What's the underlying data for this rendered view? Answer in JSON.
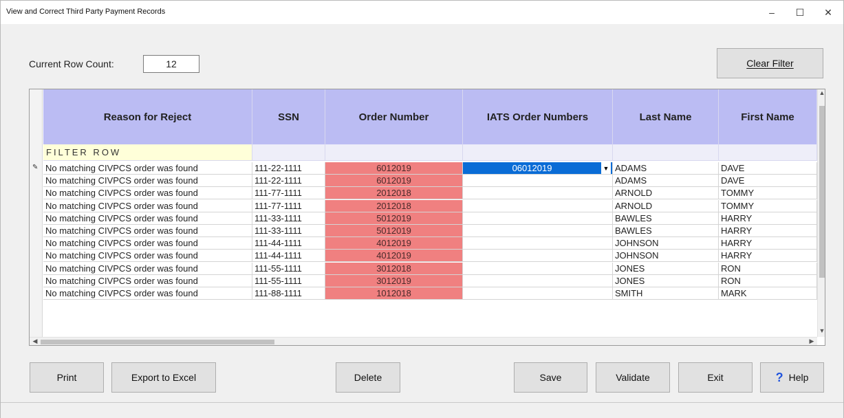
{
  "window": {
    "title": "View and Correct Third Party Payment Records",
    "minimize": "–",
    "maximize": "☐",
    "close": "✕"
  },
  "row_count": {
    "label": "Current Row Count:",
    "value": "12"
  },
  "buttons": {
    "clear_filter": "Clear Filter",
    "print": "Print",
    "export": "Export to Excel",
    "delete": "Delete",
    "save": "Save",
    "validate": "Validate",
    "exit": "Exit",
    "help": "Help"
  },
  "grid": {
    "columns": [
      "Reason for Reject",
      "SSN",
      "Order Number",
      "IATS Order Numbers",
      "Last Name",
      "First Name"
    ],
    "filter_label": "FILTER ROW",
    "selected_value": "06012019",
    "rows": [
      {
        "reason": "No matching CIVPCS order was found",
        "ssn": "111-22-1111",
        "order": "6012019",
        "iats": "06012019",
        "last": "ADAMS",
        "first": "DAVE"
      },
      {
        "reason": "No matching CIVPCS order was found",
        "ssn": "111-22-1111",
        "order": "6012019",
        "iats": "",
        "last": "ADAMS",
        "first": "DAVE"
      },
      {
        "reason": "No matching CIVPCS order was found",
        "ssn": "111-77-1111",
        "order": "2012018",
        "iats": "",
        "last": "ARNOLD",
        "first": "TOMMY"
      },
      {
        "reason": "No matching CIVPCS order was found",
        "ssn": "111-77-1111",
        "order": "2012018",
        "iats": "",
        "last": "ARNOLD",
        "first": "TOMMY"
      },
      {
        "reason": "No matching CIVPCS order was found",
        "ssn": "111-33-1111",
        "order": "5012019",
        "iats": "",
        "last": "BAWLES",
        "first": "HARRY"
      },
      {
        "reason": "No matching CIVPCS order was found",
        "ssn": "111-33-1111",
        "order": "5012019",
        "iats": "",
        "last": "BAWLES",
        "first": "HARRY"
      },
      {
        "reason": "No matching CIVPCS order was found",
        "ssn": "111-44-1111",
        "order": "4012019",
        "iats": "",
        "last": "JOHNSON",
        "first": "HARRY"
      },
      {
        "reason": "No matching CIVPCS order was found",
        "ssn": "111-44-1111",
        "order": "4012019",
        "iats": "",
        "last": "JOHNSON",
        "first": "HARRY"
      },
      {
        "reason": "No matching CIVPCS order was found",
        "ssn": "111-55-1111",
        "order": "3012018",
        "iats": "",
        "last": "JONES",
        "first": "RON"
      },
      {
        "reason": "No matching CIVPCS order was found",
        "ssn": "111-55-1111",
        "order": "3012019",
        "iats": "",
        "last": "JONES",
        "first": "RON"
      },
      {
        "reason": "No matching CIVPCS order was found",
        "ssn": "111-88-1111",
        "order": "1012018",
        "iats": "",
        "last": "SMITH",
        "first": "MARK"
      }
    ]
  },
  "colors": {
    "header": "#bbbcf3",
    "order_cell": "#f08080",
    "selected": "#0a6cd6",
    "filter": "#ffffd9"
  },
  "icons": {
    "edit_row": "pencil-icon",
    "help": "question-icon",
    "dropdown": "chevron-down-icon"
  }
}
